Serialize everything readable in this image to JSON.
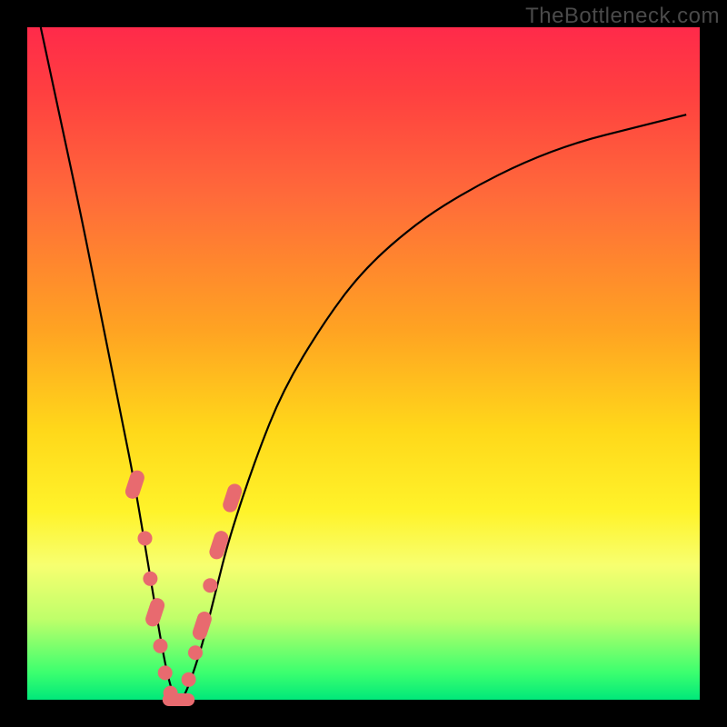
{
  "watermark": "TheBottleneck.com",
  "domain": "Chart",
  "chart_data": {
    "type": "line",
    "title": "",
    "xlabel": "",
    "ylabel": "",
    "xlim": [
      0,
      100
    ],
    "ylim": [
      0,
      100
    ],
    "grid": false,
    "series": [
      {
        "name": "bottleneck-curve",
        "x": [
          2,
          5,
          8,
          10,
          12,
          14,
          16,
          18,
          19,
          20,
          21,
          22,
          23,
          24,
          26,
          28,
          30,
          34,
          38,
          44,
          50,
          58,
          66,
          74,
          82,
          90,
          98
        ],
        "y": [
          100,
          86,
          72,
          62,
          52,
          42,
          32,
          20,
          14,
          8,
          3,
          0,
          0,
          2,
          8,
          16,
          24,
          36,
          46,
          56,
          64,
          71,
          76,
          80,
          83,
          85,
          87
        ]
      }
    ],
    "markers": {
      "name": "highlight-points",
      "color": "#e86a6f",
      "points": [
        {
          "x": 16.0,
          "y": 32,
          "kind": "pill"
        },
        {
          "x": 17.5,
          "y": 24,
          "kind": "dot"
        },
        {
          "x": 18.3,
          "y": 18,
          "kind": "dot"
        },
        {
          "x": 19.0,
          "y": 13,
          "kind": "pill"
        },
        {
          "x": 19.8,
          "y": 8,
          "kind": "dot"
        },
        {
          "x": 20.5,
          "y": 4,
          "kind": "dot"
        },
        {
          "x": 21.3,
          "y": 1,
          "kind": "dot"
        },
        {
          "x": 22.0,
          "y": 0,
          "kind": "pill-h"
        },
        {
          "x": 23.0,
          "y": 0,
          "kind": "pill-h"
        },
        {
          "x": 24.0,
          "y": 3,
          "kind": "dot"
        },
        {
          "x": 25.0,
          "y": 7,
          "kind": "dot"
        },
        {
          "x": 26.0,
          "y": 11,
          "kind": "pill"
        },
        {
          "x": 27.2,
          "y": 17,
          "kind": "dot"
        },
        {
          "x": 28.5,
          "y": 23,
          "kind": "pill"
        },
        {
          "x": 30.5,
          "y": 30,
          "kind": "pill"
        }
      ]
    }
  }
}
